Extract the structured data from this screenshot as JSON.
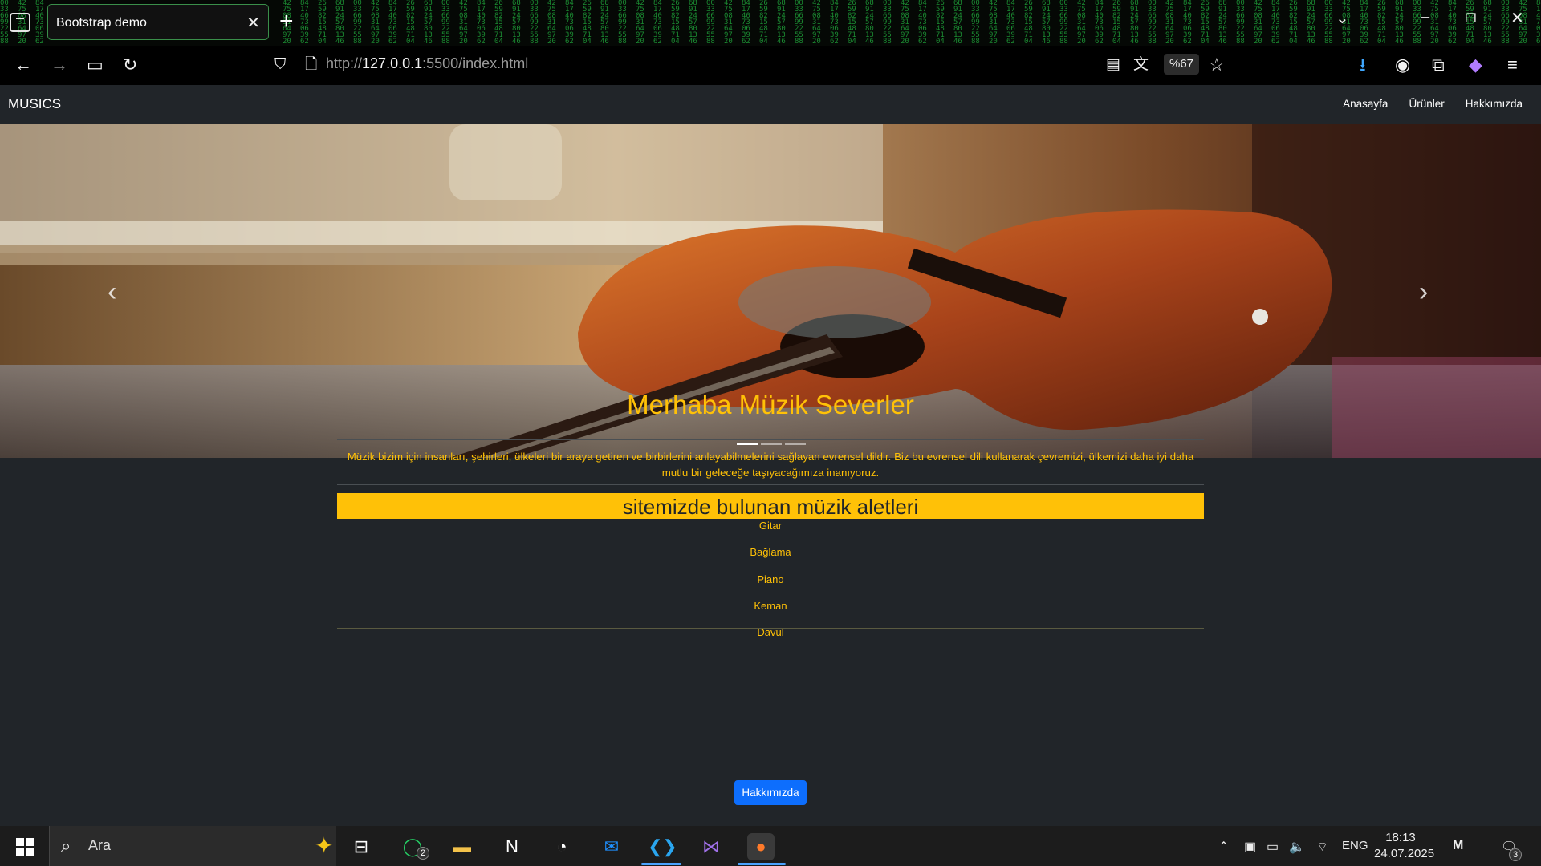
{
  "browser": {
    "tab_title": "Bootstrap demo",
    "url_prefix": "http://",
    "url_host": "127.0.0.1",
    "url_rest": ":5500/index.html",
    "zoom": "%67"
  },
  "site": {
    "brand": "MUSICS",
    "nav": [
      "Anasayfa",
      "Ürünler",
      "Hakkımızda"
    ],
    "title": "Merhaba Müzik Severler",
    "intro": "Müzik bizim için insanları, şehirleri, ülkeleri bir araya getiren ve birbirlerini anlayabilmelerini sağlayan evrensel dildir. Biz bu evrensel dili kullanarak çevremizi, ülkemizi daha iyi daha mutlu bir geleceğe taşıyacağımıza inanıyoruz.",
    "section_heading": "sitemizde bulunan müzik aletleri",
    "instruments": [
      "Gitar",
      "Bağlama",
      "Piano",
      "Keman",
      "Davul"
    ],
    "about_button": "Hakkımızda",
    "carousel_slides": 3,
    "carousel_active": 0
  },
  "taskbar": {
    "search_placeholder": "Ara",
    "whatsapp_badge": "2",
    "notification_badge": "3",
    "lang": "ENG",
    "time": "18:13",
    "date": "24.07.2025"
  },
  "colors": {
    "accent": "#ffc107",
    "page_bg": "#212529",
    "button": "#0d6efd"
  }
}
